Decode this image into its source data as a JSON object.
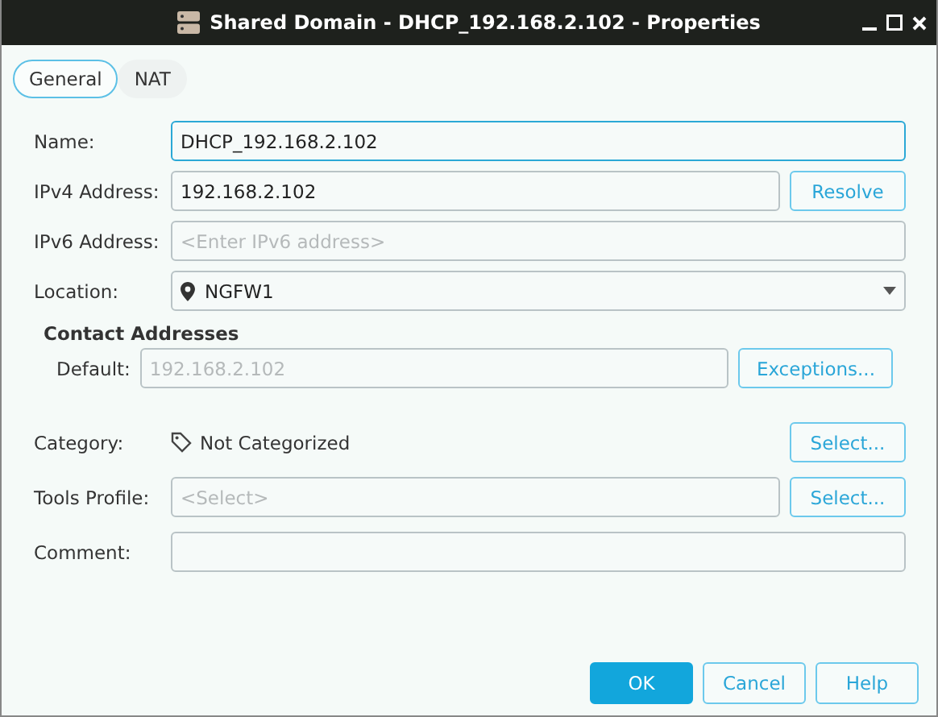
{
  "window": {
    "title": "Shared Domain - DHCP_192.168.2.102 - Properties"
  },
  "tabs": [
    {
      "label": "General",
      "selected": true
    },
    {
      "label": "NAT",
      "selected": false
    }
  ],
  "fields": [
    {
      "kind": "text",
      "label": "Name:",
      "value": "DHCP_192.168.2.102",
      "focused": true
    },
    {
      "kind": "text",
      "label": "IPv4 Address:",
      "value": "192.168.2.102",
      "focused": false,
      "button": "Resolve"
    },
    {
      "kind": "text",
      "label": "IPv6 Address:",
      "placeholder": "<Enter IPv6 address>",
      "focused": false
    },
    {
      "kind": "dropdown",
      "label": "Location:",
      "value": "NGFW1"
    }
  ],
  "contact_addresses": {
    "heading": "Contact Addresses",
    "label": "Default:",
    "placeholder": "192.168.2.102",
    "button": "Exceptions..."
  },
  "fields_2": [
    {
      "kind": "static",
      "label": "Category:",
      "value": "Not Categorized",
      "button": "Select..."
    },
    {
      "kind": "text",
      "label": "Tools Profile:",
      "placeholder": "<Select>",
      "focused": false,
      "button": "Select..."
    },
    {
      "kind": "text",
      "label": "Comment:",
      "focused": false
    }
  ],
  "buttons": [
    {
      "label": "OK",
      "primary": true
    },
    {
      "label": "Cancel",
      "primary": false
    },
    {
      "label": "Help",
      "primary": false
    }
  ]
}
